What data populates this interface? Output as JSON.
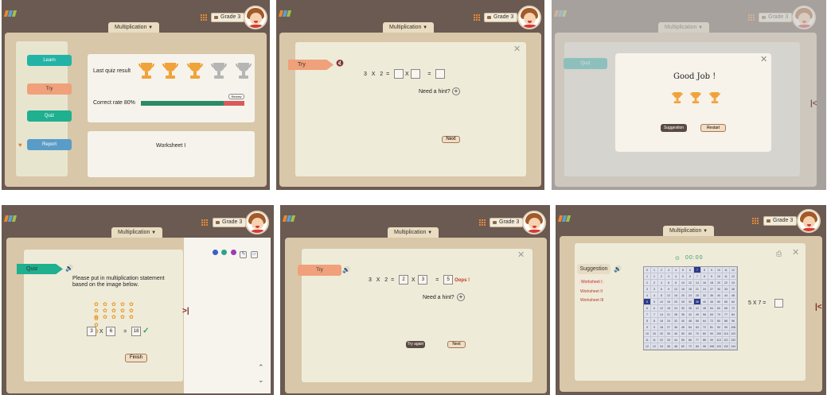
{
  "common": {
    "grade_label": "Grade 3",
    "subject_label": "Multiplication",
    "accent": "#e08a3a"
  },
  "panel1": {
    "nav": {
      "learn": "Learn",
      "try": "Try",
      "quiz": "Quiz",
      "report": "Report"
    },
    "last_quiz_label": "Last quiz result",
    "trophies": {
      "earned": 3,
      "total": 5
    },
    "review_label": "Review",
    "correct_rate_label": "Correct rate 80%",
    "correct_rate": 0.8,
    "worksheet_label": "Worksheet I"
  },
  "panel2": {
    "try_label": "Try",
    "eq_a": "3",
    "eq_x": "X",
    "eq_b": "2",
    "eq_eq": "=",
    "eq_x2": "X",
    "eq_eq2": "=",
    "hint_label": "Need a hint?",
    "next_label": "Next"
  },
  "panel3": {
    "title": "Good Job !",
    "trophies": 3,
    "suggestion_label": "Suggestion",
    "restart_label": "Restart"
  },
  "panel4": {
    "quiz_label": "Quiz",
    "instruction_line1": "Please put in multiplication statement",
    "instruction_line2": "based on the image below.",
    "stars_rows": 3,
    "stars_cols": 6,
    "a": "3",
    "x": "X",
    "b": "6",
    "eq": "=",
    "result": "18",
    "finish_label": "Finish",
    "colors": [
      "#3b5fc6",
      "#2aa38a",
      "#9b3bb5"
    ]
  },
  "panel5": {
    "try_label": "Try",
    "eq_a": "3",
    "eq_x": "X",
    "eq_b": "2",
    "eq_eq": "=",
    "box1": "2",
    "eq_x2": "X",
    "box2": "3",
    "eq_eq2": "=",
    "box3": "5",
    "oops": "Oops !",
    "hint_label": "Need a hint?",
    "try_again_label": "Try again",
    "next_label": "Next"
  },
  "panel6": {
    "suggestion_label": "Suggestion",
    "worksheets": [
      "Worksheet I",
      "Worksheet II",
      "Worksheet III"
    ],
    "timer": "00:00",
    "question": "5 X 7 ="
  }
}
